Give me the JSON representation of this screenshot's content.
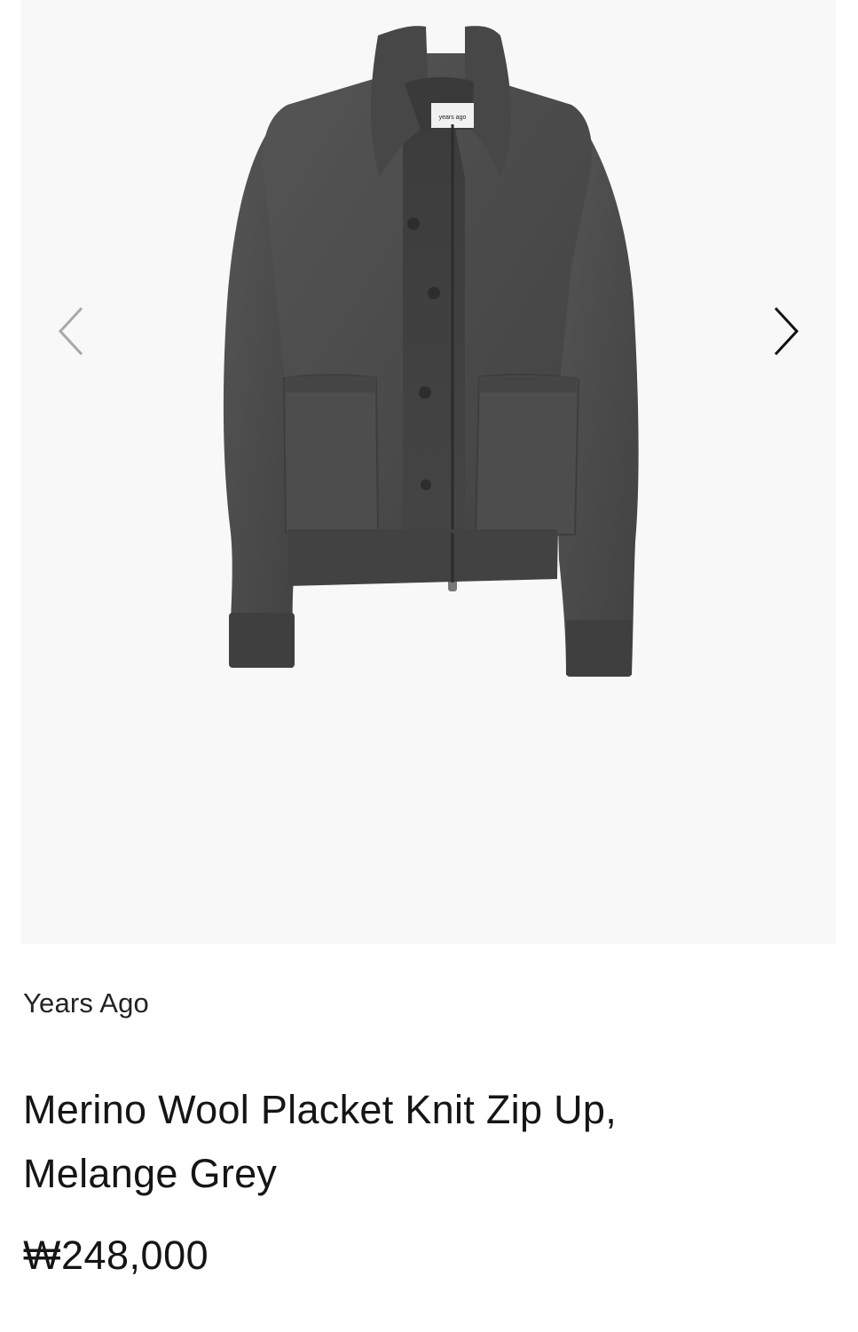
{
  "gallery": {
    "tag_label": "years ago",
    "prev_icon": "chevron-left-icon",
    "next_icon": "chevron-right-icon"
  },
  "product": {
    "brand": "Years Ago",
    "title_line1": "Merino Wool Placket Knit Zip Up,",
    "title_line2": "Melange Grey",
    "price": "₩248,000"
  },
  "colors": {
    "gallery_bg": "#f8f8f8",
    "garment": "#4a4a4a",
    "text": "#151515"
  }
}
